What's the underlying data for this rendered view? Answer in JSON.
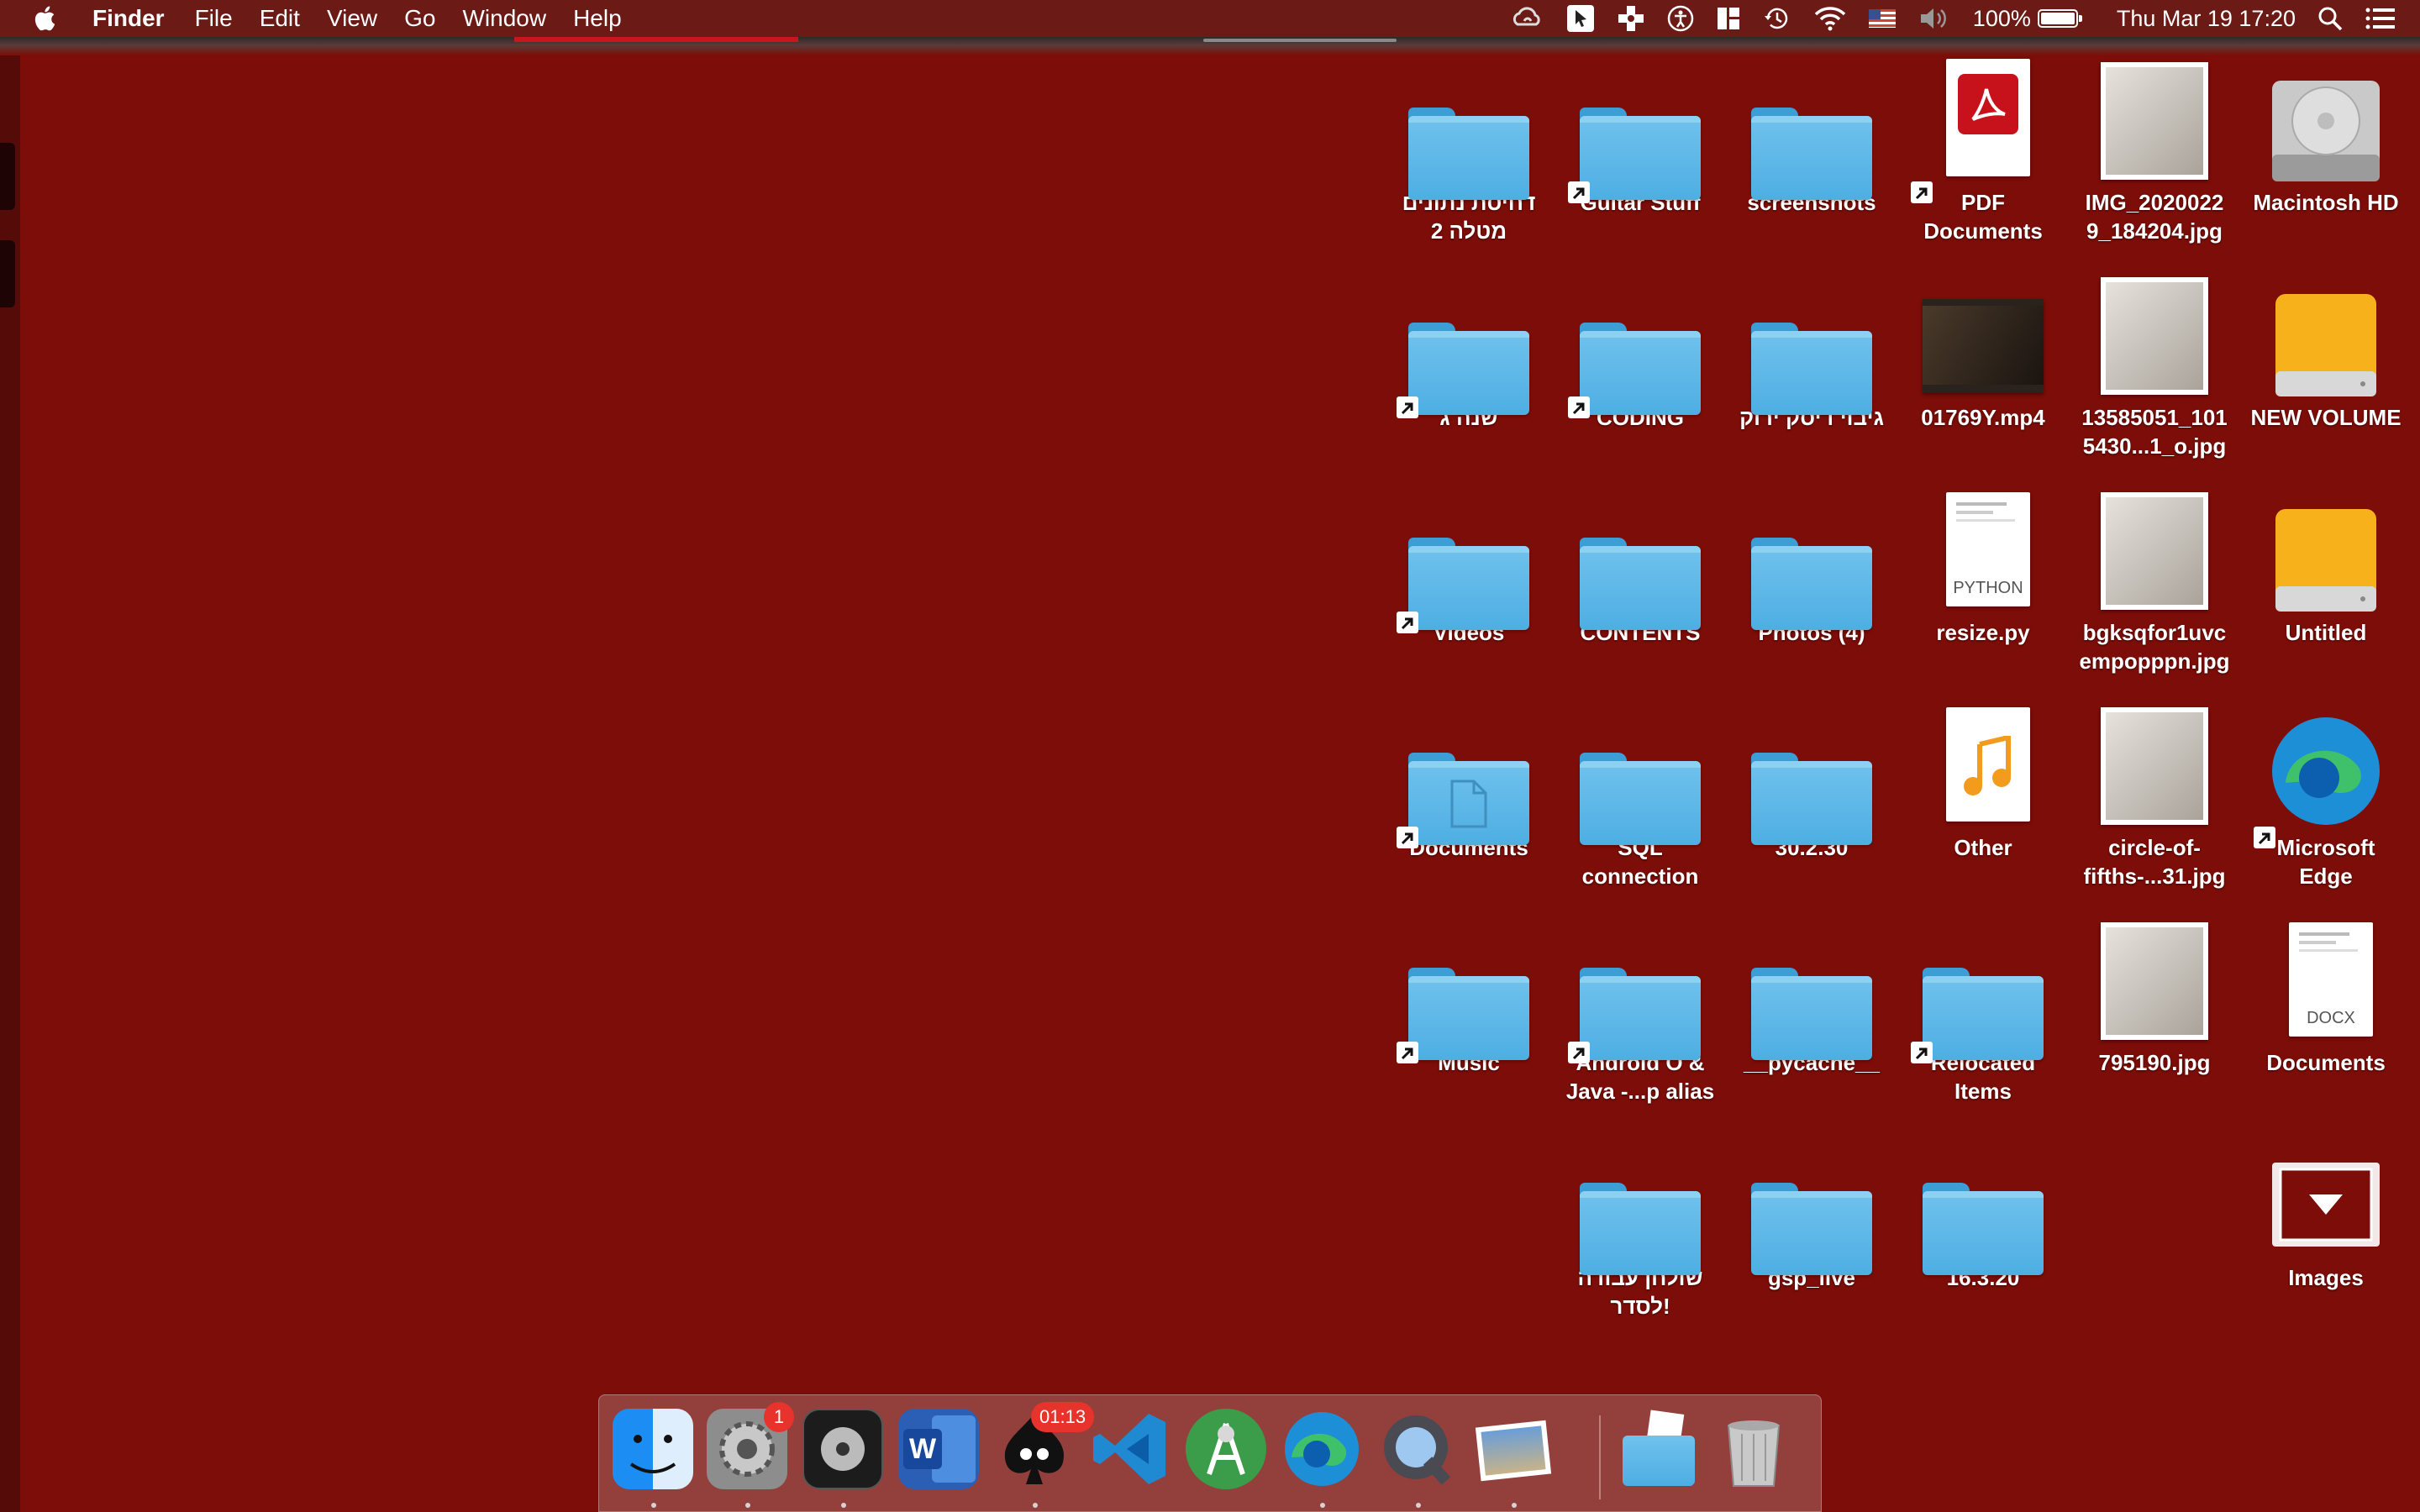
{
  "menubar": {
    "app_name": "Finder",
    "menus": [
      "File",
      "Edit",
      "View",
      "Go",
      "Window",
      "Help"
    ],
    "battery_percent": "100%",
    "battery_level": 1.0,
    "datetime": "Thu Mar 19  17:20",
    "status_icons": [
      "creative-cloud-icon",
      "cursor-tool-icon",
      "plus-cross-icon",
      "accessibility-icon",
      "window-layout-icon",
      "time-machine-icon",
      "wifi-icon",
      "us-flag-icon",
      "volume-icon",
      "battery-icon",
      "spotlight-search-icon",
      "notification-center-icon"
    ]
  },
  "desktop": {
    "items": [
      {
        "label": "דחיסת נתונים\nמטלה 2",
        "type": "folder",
        "alias": false
      },
      {
        "label": "Guitar Stuff",
        "type": "folder",
        "alias": true
      },
      {
        "label": "screenshots",
        "type": "folder",
        "alias": false
      },
      {
        "label": "PDF\nDocuments",
        "type": "pdf",
        "alias": true
      },
      {
        "label": "IMG_2020022\n9_184204.jpg",
        "type": "image",
        "alias": false
      },
      {
        "label": "Macintosh HD",
        "type": "hdd",
        "alias": false
      },
      {
        "label": "שנה ג",
        "type": "folder",
        "alias": true
      },
      {
        "label": "CODING",
        "type": "folder",
        "alias": true
      },
      {
        "label": "גיבוי דיסק ירוק",
        "type": "folder",
        "alias": false
      },
      {
        "label": "01769Y.mp4",
        "type": "video",
        "alias": false
      },
      {
        "label": "13585051_101\n5430...1_o.jpg",
        "type": "image",
        "alias": false
      },
      {
        "label": "NEW VOLUME",
        "type": "external-drive",
        "alias": false
      },
      {
        "label": "Videos",
        "type": "folder",
        "alias": true
      },
      {
        "label": "CONTENTS",
        "type": "folder",
        "alias": false
      },
      {
        "label": "Photos (4)",
        "type": "folder",
        "alias": false
      },
      {
        "label": "resize.py",
        "type": "python",
        "ext": "PYTHON",
        "alias": false
      },
      {
        "label": "bgksqfor1uvc\nempopppn.jpg",
        "type": "image",
        "alias": false
      },
      {
        "label": "Untitled",
        "type": "external-drive",
        "alias": false
      },
      {
        "label": "Documents",
        "type": "folder-docs",
        "alias": true
      },
      {
        "label": "SQL\nconnection",
        "type": "folder",
        "alias": false
      },
      {
        "label": "30.2.30",
        "type": "folder",
        "alias": false
      },
      {
        "label": "Other",
        "type": "audio",
        "alias": false
      },
      {
        "label": "circle-of-\nfifths-...31.jpg",
        "type": "image",
        "alias": false
      },
      {
        "label": "Microsoft\nEdge",
        "type": "edge",
        "alias": true
      },
      {
        "label": "Music",
        "type": "folder",
        "alias": true
      },
      {
        "label": "Android O &\nJava -...p alias",
        "type": "folder",
        "alias": true
      },
      {
        "label": "__pycache__",
        "type": "folder",
        "alias": false
      },
      {
        "label": "Relocated\nItems",
        "type": "folder",
        "alias": true
      },
      {
        "label": "795190.jpg",
        "type": "image",
        "alias": false
      },
      {
        "label": "Documents",
        "type": "docx",
        "ext": "DOCX",
        "alias": false
      },
      {
        "label": "שולחן עבודה\nלסדר!",
        "type": "folder",
        "alias": false
      },
      {
        "label": "gsp_live",
        "type": "folder",
        "alias": false
      },
      {
        "label": "16.3.20",
        "type": "folder",
        "alias": false
      },
      {
        "label": "Images",
        "type": "dmg",
        "alias": false
      }
    ]
  },
  "dock": {
    "apps": [
      {
        "name": "Finder",
        "icon": "finder-icon",
        "running": true
      },
      {
        "name": "System Preferences",
        "icon": "system-preferences-icon",
        "running": true,
        "badge": "1"
      },
      {
        "name": "Logic Pro",
        "icon": "logic-pro-icon",
        "running": true
      },
      {
        "name": "Microsoft Word",
        "icon": "word-icon",
        "running": false
      },
      {
        "name": "Solitaire",
        "icon": "solitaire-icon",
        "running": true,
        "badge": "01:13"
      },
      {
        "name": "Visual Studio Code",
        "icon": "vscode-icon",
        "running": false
      },
      {
        "name": "Android Studio",
        "icon": "android-studio-icon",
        "running": false
      },
      {
        "name": "Microsoft Edge",
        "icon": "edge-icon",
        "running": true
      },
      {
        "name": "QuickTime Player",
        "icon": "quicktime-icon",
        "running": true
      },
      {
        "name": "Preview",
        "icon": "preview-icon",
        "running": true
      },
      {
        "name": "Downloads",
        "icon": "downloads-stack-icon",
        "running": false
      },
      {
        "name": "Trash",
        "icon": "trash-icon",
        "running": false
      }
    ],
    "word_letter": "W"
  }
}
